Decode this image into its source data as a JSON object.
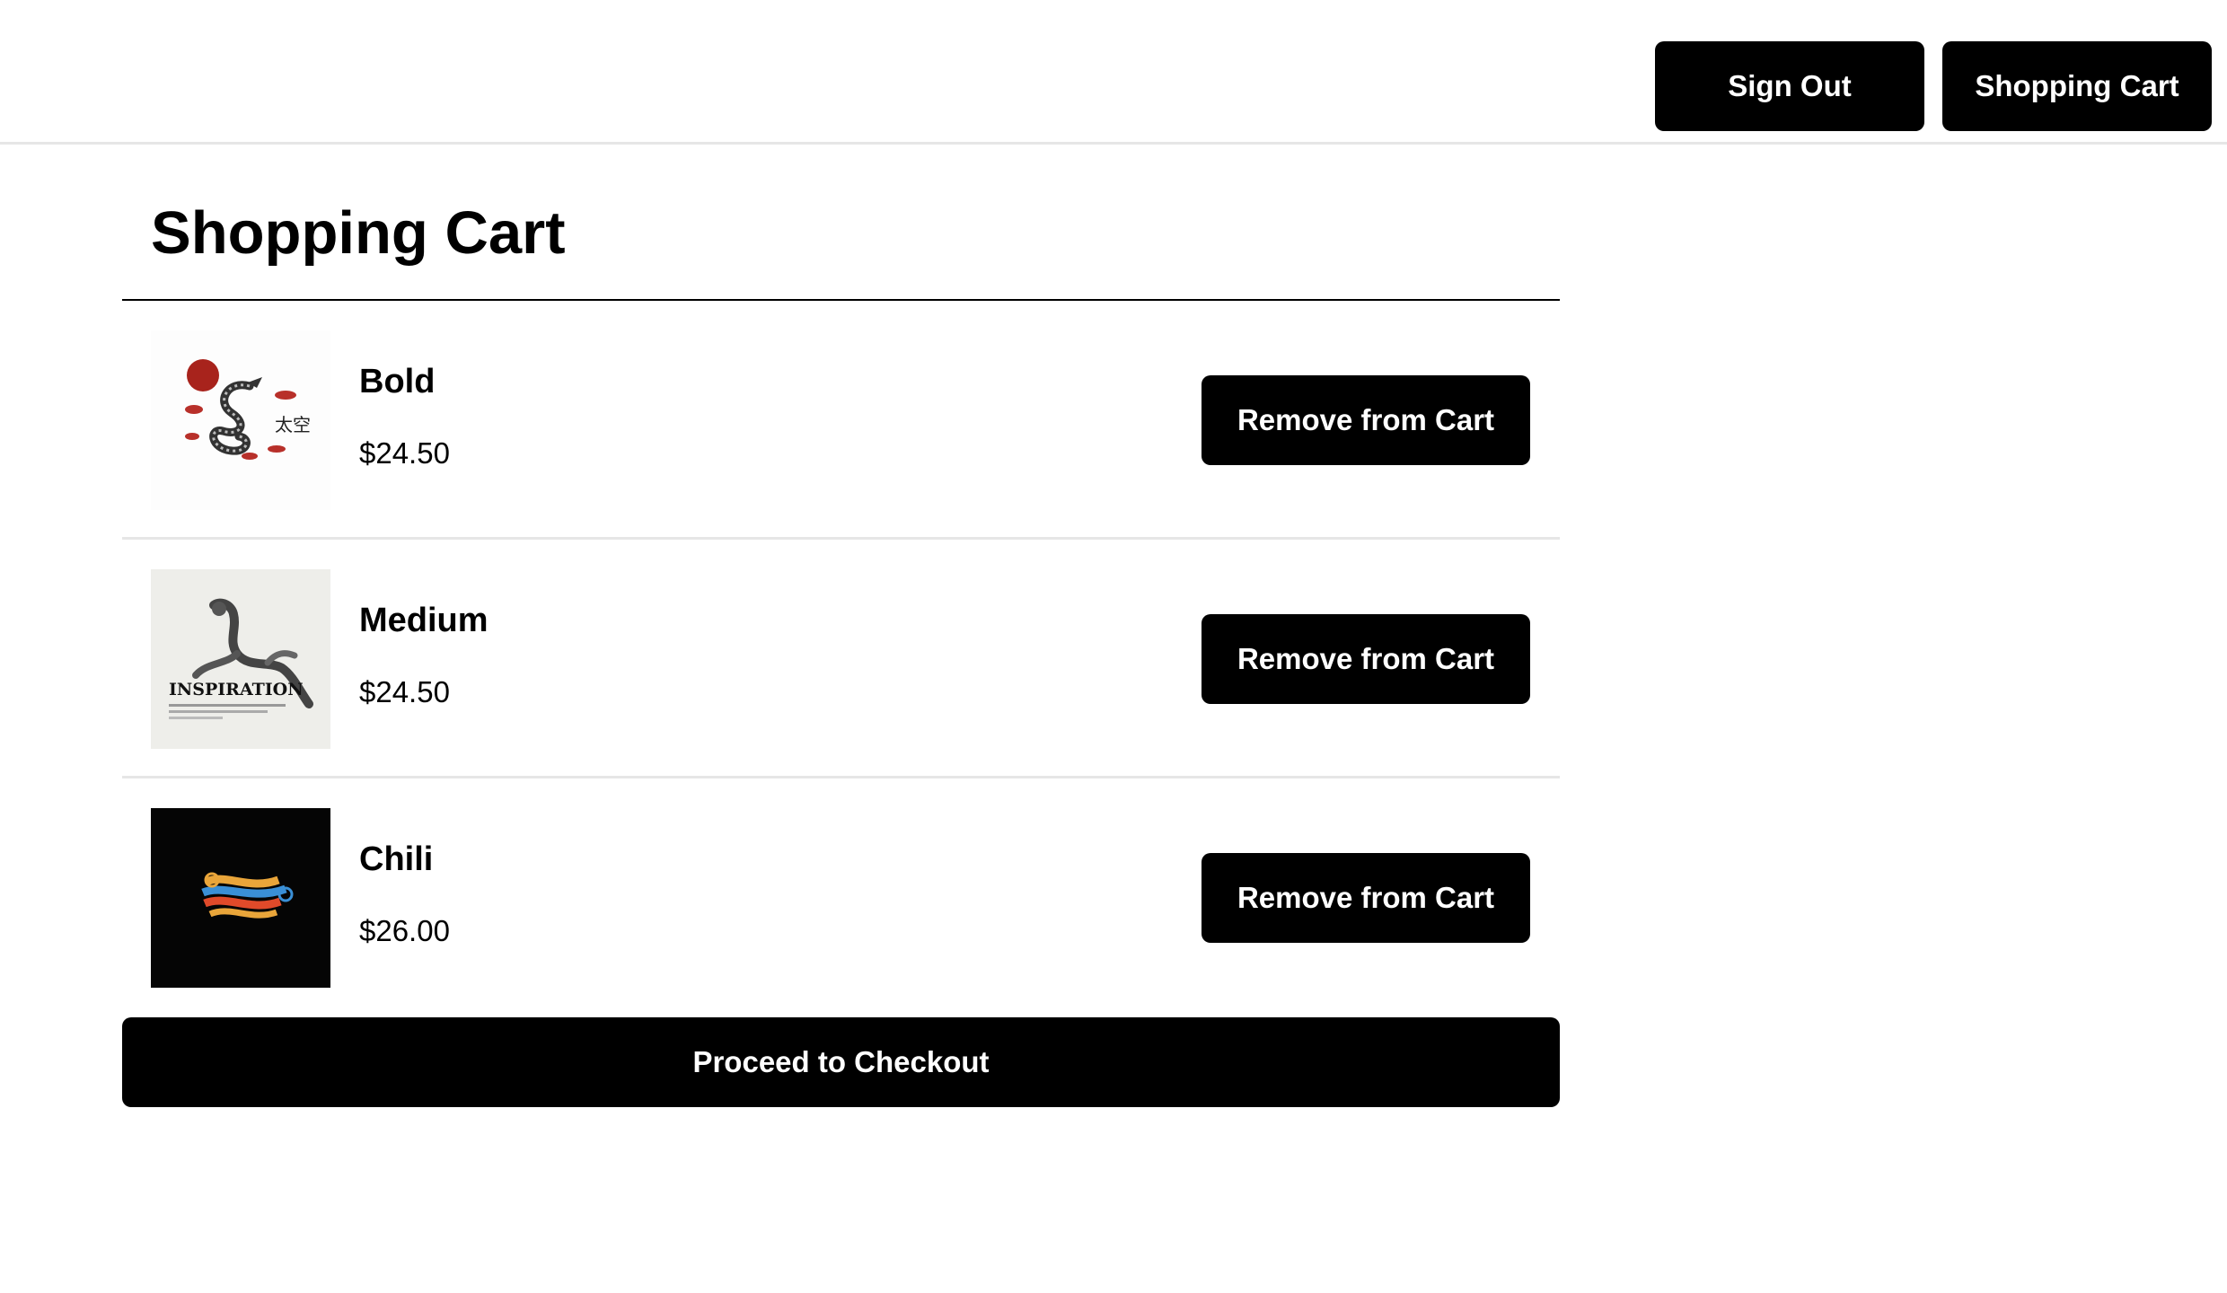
{
  "header": {
    "sign_out_label": "Sign Out",
    "cart_label": "Shopping Cart"
  },
  "page": {
    "title": "Shopping Cart"
  },
  "cart": {
    "items": [
      {
        "name": "Bold",
        "price": "$24.50",
        "remove_label": "Remove from Cart",
        "image": "dragon-shirt-design",
        "image_text": "太空"
      },
      {
        "name": "Medium",
        "price": "$24.50",
        "remove_label": "Remove from Cart",
        "image": "inspiration-statue-design",
        "image_text": "INSPIRATION"
      },
      {
        "name": "Chili",
        "price": "$26.00",
        "remove_label": "Remove from Cart",
        "image": "retro-wavy-text-design"
      }
    ],
    "checkout_label": "Proceed to Checkout"
  },
  "colors": {
    "button_bg": "#000000",
    "button_text": "#ffffff",
    "divider": "#e6e6e6"
  }
}
